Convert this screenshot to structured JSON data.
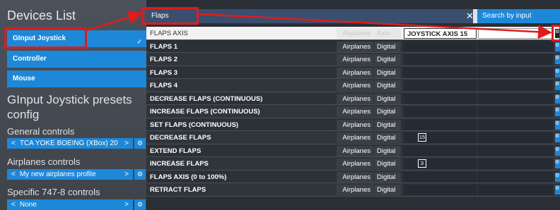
{
  "devices": {
    "title": "Devices List",
    "items": [
      {
        "label": "GInput Joystick",
        "selected": true
      },
      {
        "label": "Controller",
        "selected": false
      },
      {
        "label": "Mouse",
        "selected": false
      }
    ]
  },
  "presets": {
    "title": "GInput Joystick presets config",
    "sections": [
      {
        "label": "General controls",
        "value": "TCA YOKE BOEING (XBox) 20"
      },
      {
        "label": "Airplanes controls",
        "value": "My new airplanes profile"
      },
      {
        "label": "Specific 747-8 controls",
        "value": "None"
      }
    ]
  },
  "search": {
    "value": "Flaps",
    "clear_icon": "close-icon",
    "search_by_input_label": "Search by input"
  },
  "table": {
    "rows": [
      {
        "name": "FLAPS AXIS",
        "tag1": "Airplanes",
        "tag2": "Axis",
        "binding": "JOYSTICK AXIS 15",
        "key": "",
        "highlight": true
      },
      {
        "name": "FLAPS 1",
        "tag1": "Airplanes",
        "tag2": "Digital",
        "binding": "",
        "key": ""
      },
      {
        "name": "FLAPS 2",
        "tag1": "Airplanes",
        "tag2": "Digital",
        "binding": "",
        "key": ""
      },
      {
        "name": "FLAPS 3",
        "tag1": "Airplanes",
        "tag2": "Digital",
        "binding": "",
        "key": ""
      },
      {
        "name": "FLAPS 4",
        "tag1": "Airplanes",
        "tag2": "Digital",
        "binding": "",
        "key": ""
      },
      {
        "name": "DECREASE FLAPS (CONTINUOUS)",
        "tag1": "Airplanes",
        "tag2": "Digital",
        "binding": "",
        "key": ""
      },
      {
        "name": "INCREASE FLAPS (CONTINUOUS)",
        "tag1": "Airplanes",
        "tag2": "Digital",
        "binding": "",
        "key": ""
      },
      {
        "name": "SET FLAPS (CONTINUOUS)",
        "tag1": "Airplanes",
        "tag2": "Digital",
        "binding": "",
        "key": ""
      },
      {
        "name": "DECREASE FLAPS",
        "tag1": "Airplanes",
        "tag2": "Digital",
        "binding": "",
        "key": "15"
      },
      {
        "name": "EXTEND FLAPS",
        "tag1": "Airplanes",
        "tag2": "Digital",
        "binding": "",
        "key": ""
      },
      {
        "name": "INCREASE FLAPS",
        "tag1": "Airplanes",
        "tag2": "Digital",
        "binding": "",
        "key": "3"
      },
      {
        "name": "FLAPS AXIS (0 to 100%)",
        "tag1": "Airplanes",
        "tag2": "Digital",
        "binding": "",
        "key": ""
      },
      {
        "name": "RETRACT FLAPS",
        "tag1": "Airplanes",
        "tag2": "Digital",
        "binding": "",
        "key": ""
      }
    ]
  },
  "colors": {
    "accent": "#1e88d8",
    "annotation": "#e01b1b"
  }
}
